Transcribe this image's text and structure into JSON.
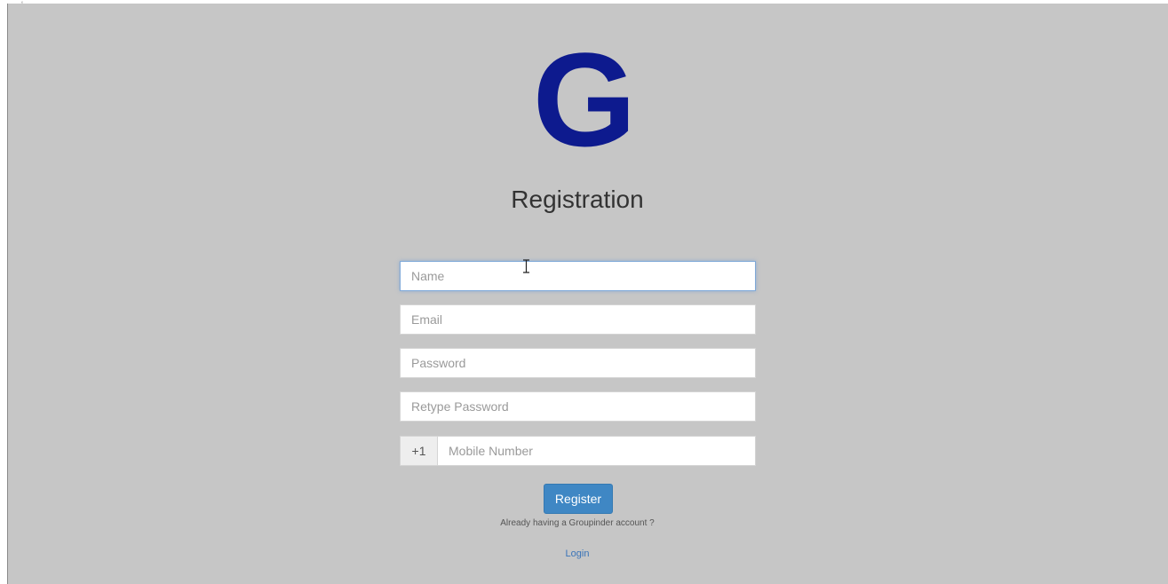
{
  "logo": {
    "letter": "G",
    "color": "#0d1a8e"
  },
  "page": {
    "title": "Registration",
    "background": "#c6c6c6"
  },
  "form": {
    "name": {
      "placeholder": "Name",
      "value": ""
    },
    "email": {
      "placeholder": "Email",
      "value": ""
    },
    "password": {
      "placeholder": "Password",
      "value": ""
    },
    "retype_password": {
      "placeholder": "Retype Password",
      "value": ""
    },
    "mobile": {
      "prefix": "+1",
      "placeholder": "Mobile Number",
      "value": ""
    },
    "register_label": "Register",
    "register_color": "#3f87c4"
  },
  "footer": {
    "already_text": "Already having a Groupinder account ?",
    "login_label": "Login",
    "link_color": "#3a74b8"
  },
  "cursor": {
    "icon": "text-cursor-icon",
    "glyph": "I"
  }
}
